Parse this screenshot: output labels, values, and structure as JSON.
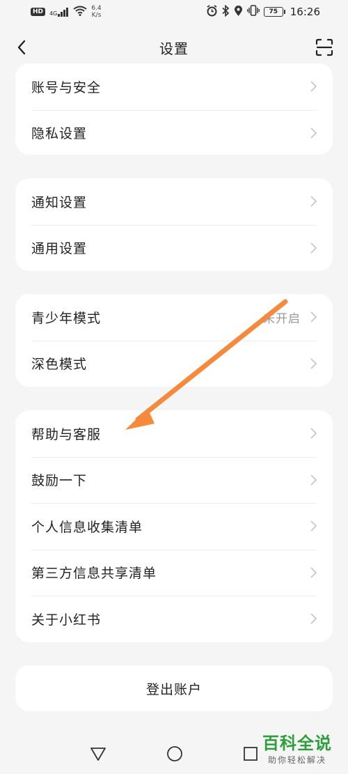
{
  "status_bar": {
    "hd": "HD",
    "signal_label": "4G",
    "net_speed_value": "6.4",
    "net_speed_unit": "K/s",
    "battery": "75",
    "time": "16:26"
  },
  "header": {
    "title": "设置",
    "back_icon": "chevron-left-icon",
    "scan_icon": "scan-icon"
  },
  "groups": [
    {
      "items": [
        {
          "label": "账号与安全"
        },
        {
          "label": "隐私设置"
        }
      ]
    },
    {
      "items": [
        {
          "label": "通知设置"
        },
        {
          "label": "通用设置"
        }
      ]
    },
    {
      "items": [
        {
          "label": "青少年模式",
          "value": "未开启"
        },
        {
          "label": "深色模式"
        }
      ]
    },
    {
      "items": [
        {
          "label": "帮助与客服"
        },
        {
          "label": "鼓励一下"
        },
        {
          "label": "个人信息收集清单"
        },
        {
          "label": "第三方信息共享清单"
        },
        {
          "label": "关于小红书"
        }
      ]
    }
  ],
  "logout_label": "登出账户",
  "colors": {
    "accent_arrow": "#f58a3c",
    "watermark_green": "#2e9e3c"
  },
  "watermark": {
    "title": "百科全说",
    "subtitle": "助你轻松解决"
  }
}
